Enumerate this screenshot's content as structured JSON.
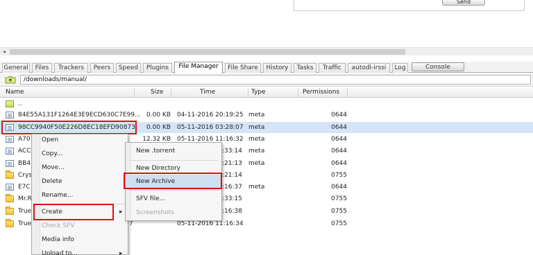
{
  "top": {
    "send_label": "Send"
  },
  "tabs": [
    {
      "label": "General"
    },
    {
      "label": "Files"
    },
    {
      "label": "Trackers"
    },
    {
      "label": "Peers"
    },
    {
      "label": "Speed"
    },
    {
      "label": "Plugins"
    },
    {
      "label": "File Manager",
      "active": true
    },
    {
      "label": "File Share"
    },
    {
      "label": "History"
    },
    {
      "label": "Tasks"
    },
    {
      "label": "Traffic"
    },
    {
      "label": "autodl-irssi"
    },
    {
      "label": "Log"
    },
    {
      "label": "Console"
    }
  ],
  "path": {
    "value": "/downloads/manual/"
  },
  "columns": {
    "name": "Name",
    "size": "Size",
    "time": "Time",
    "type": "Type",
    "permissions": "Permissions"
  },
  "rows": [
    {
      "name": "..",
      "size": "",
      "time": "",
      "type": "",
      "perm": "",
      "icon": "up-folder-icon"
    },
    {
      "name": "84E55A131F1264E3E9ECD630C7E99...",
      "size": "0.00 KB",
      "time": "04-11-2016 20:19:25",
      "type": "meta",
      "perm": "0644",
      "icon": "file-icon"
    },
    {
      "name": "98CC9940F50E226D8EC18EFD90873",
      "size": "0.00 KB",
      "time": "05-11-2016 03:28:07",
      "type": "meta",
      "perm": "0644",
      "icon": "file-icon",
      "selected": true
    },
    {
      "name": "A70",
      "size": "12.32 KB",
      "time": "05-11-2016 11:16:32",
      "type": "meta",
      "perm": "0644",
      "icon": "file-icon"
    },
    {
      "name": "ACC",
      "size": "",
      "time": ":33:14",
      "type": "meta",
      "perm": "0644",
      "icon": "file-icon"
    },
    {
      "name": "BB4",
      "size": "",
      "time": ":21:13",
      "type": "meta",
      "perm": "0644",
      "icon": "file-icon"
    },
    {
      "name": "Crys",
      "size": "",
      "time": ":21:14",
      "type": "",
      "perm": "0755",
      "icon": "folder-icon"
    },
    {
      "name": "E7C",
      "size": "",
      "time": ":16:37",
      "type": "meta",
      "perm": "0644",
      "icon": "file-icon"
    },
    {
      "name": "Mr.R",
      "size": "",
      "time": ":33:15",
      "type": "",
      "perm": "0755",
      "icon": "folder-icon"
    },
    {
      "name": "True",
      "size": "",
      "time": ":16:38",
      "type": "",
      "perm": "0755",
      "icon": "folder-icon"
    },
    {
      "name": "True",
      "size": "7",
      "time": "05-11-2016 11:16:34",
      "type": "",
      "perm": "0755",
      "icon": "folder-icon"
    }
  ],
  "context_menu": {
    "items": [
      "Open",
      "Copy...",
      "Move...",
      "Delete",
      "Rename...",
      "Create",
      "Check SFV",
      "Media info",
      "Upload to..."
    ]
  },
  "submenu": {
    "items": [
      "New .torrent",
      "New Directory",
      "New Archive",
      "SFV file...",
      "Screenshots"
    ]
  }
}
